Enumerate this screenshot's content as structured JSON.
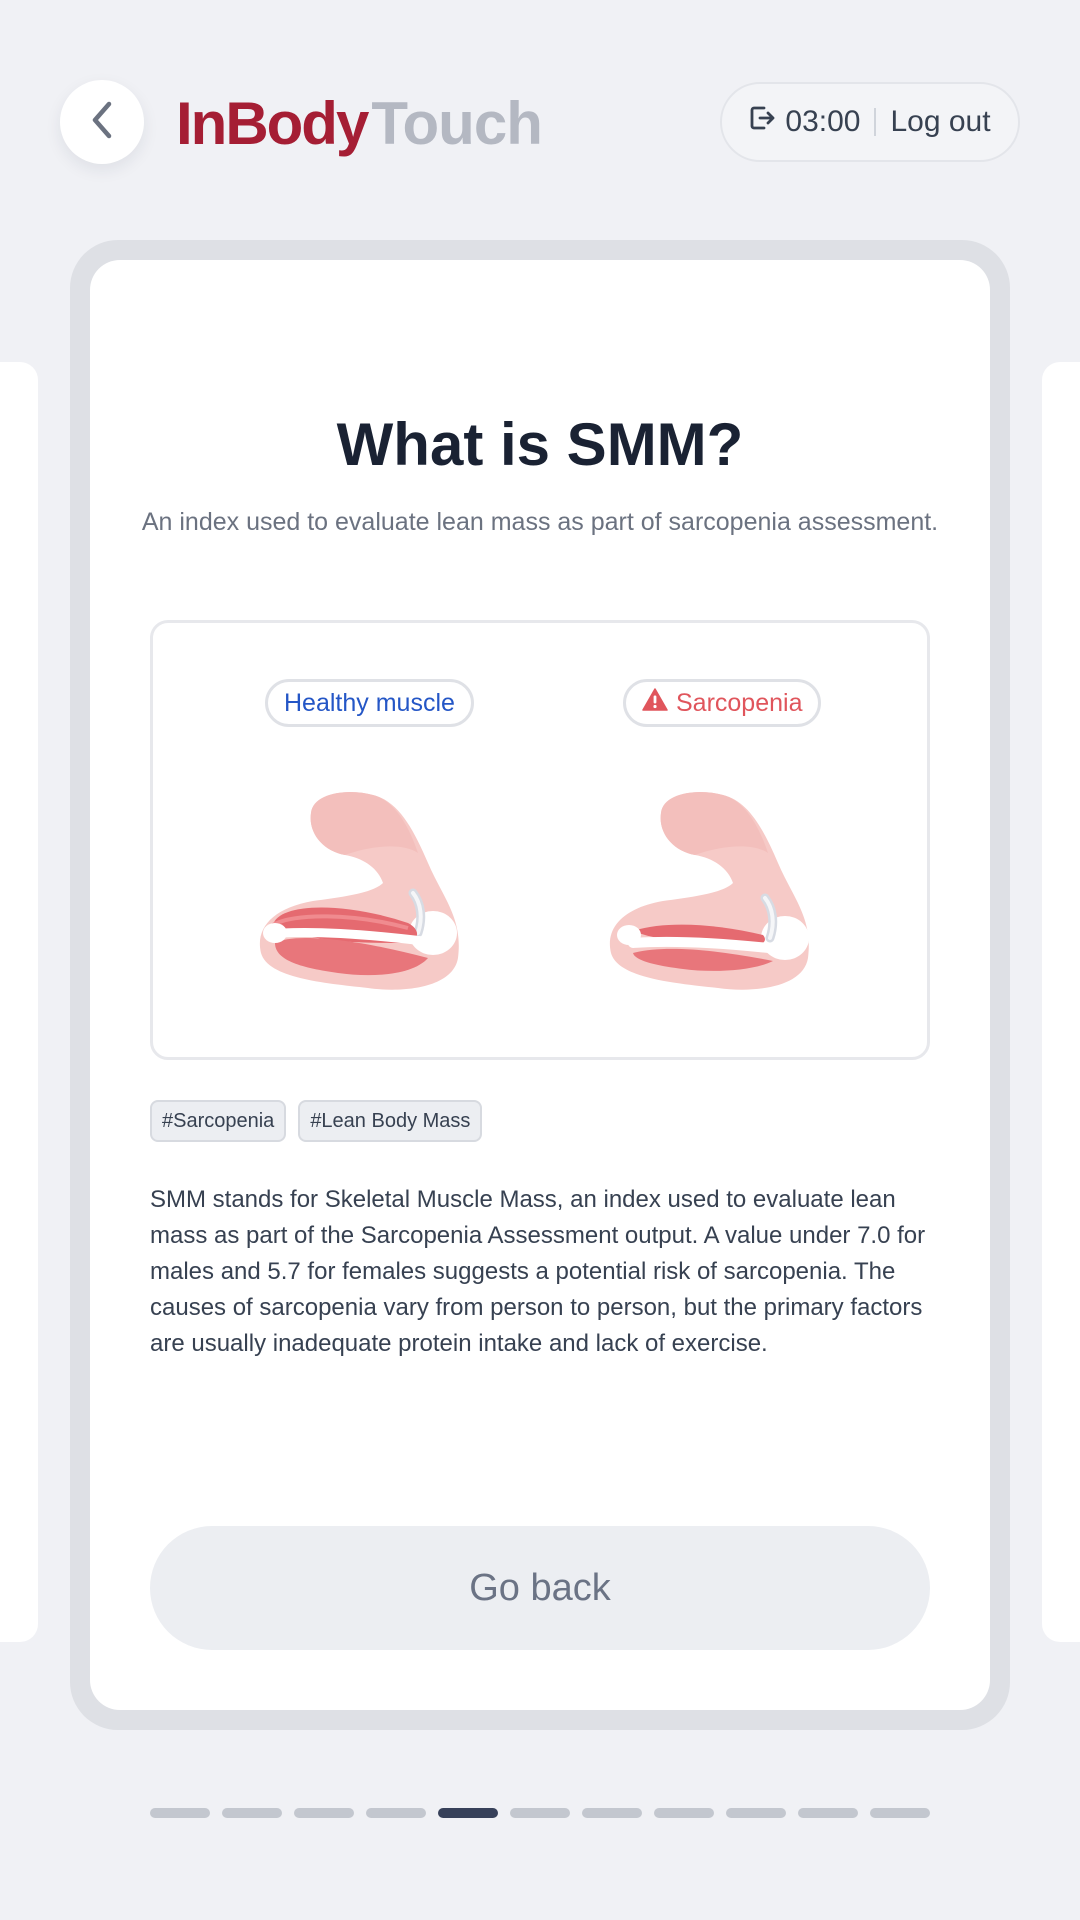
{
  "header": {
    "back_icon": "chevron-left-icon",
    "logo_brand": "InBody",
    "logo_product": "Touch",
    "timer_icon": "logout-icon",
    "timer": "03:00",
    "logout_label": "Log out"
  },
  "card": {
    "title": "What is SMM?",
    "subtitle": "An index used to evaluate lean mass as part of sarcopenia assessment.",
    "illustration": {
      "healthy_label": "Healthy muscle",
      "sarcopenia_label": "Sarcopenia",
      "warning_icon": "warning-triangle-icon"
    },
    "tags": [
      "#Sarcopenia",
      "#Lean Body Mass"
    ],
    "body": "SMM stands for Skeletal Muscle Mass, an index used to evaluate lean mass as part of the Sarcopenia Assessment output. A value under 7.0 for males and 5.7 for females suggests a potential risk of sarcopenia. The causes of sarcopenia vary from person to person, but the primary factors are usually inadequate protein intake and lack of exercise.",
    "go_back_label": "Go back"
  },
  "pagination": {
    "total": 11,
    "active_index": 4
  },
  "colors": {
    "brand": "#a51e34",
    "healthy": "#2456c6",
    "warning": "#e0555c",
    "pager_active": "#37415a"
  }
}
